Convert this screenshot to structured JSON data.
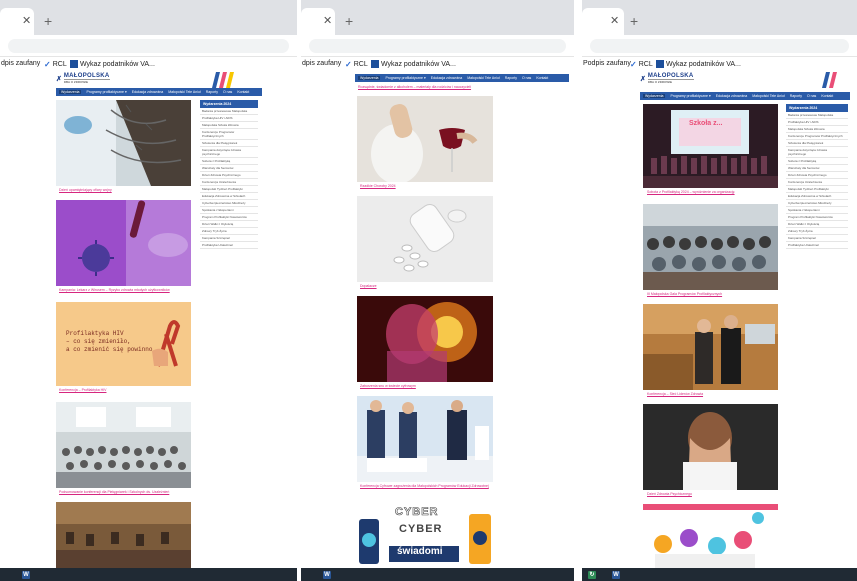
{
  "bookmarks": {
    "trusted_sig": "dpis zaufany",
    "trusted_sig_full": "Podpis zaufany",
    "rcl": "RCL",
    "tax_list": "Wykaz podatników VA..."
  },
  "site": {
    "logo_title": "MAŁOPOLSKA",
    "logo_sub": "DBA O ZDROWIE",
    "nav": [
      "Wydarzenia",
      "Programy profilaktyczne ▾",
      "Edukacja zdrowotna",
      "Małopolski Tele Anioł",
      "Raporty",
      "O nas",
      "Kontakt"
    ],
    "sidebar_title": "Wydarzenia 2024",
    "sidebar_items": [
      "Badania przesiewowe Małopolska",
      "Profilaktyka HIV i AIDS",
      "Małopolska Szkoła Zdrowia",
      "Konferencje Programów Profilaktycznych",
      "Szkolenia dla Pielęgniarek",
      "Kampania dotycząca zdrowia psychicznego",
      "Sobota z Profilaktyką",
      "Warsztaty dla Seniorów",
      "Dzień Zdrowia Psychicznego",
      "Konferencja Uzależnienia",
      "Małopolski Tydzień Profilaktyki",
      "Edukacja Zdrowotna w Szkołach",
      "Cyberbezpieczeństwo Młodzieży",
      "Spotkania z Ekspertami",
      "Program Profilaktyki Nowotworów",
      "Dzień Walki z Otyłością",
      "Zdrowy Tryb Życia",
      "Kampania Szczepień",
      "Profilaktyka Uzależnień"
    ]
  },
  "shot1": {
    "captions": [
      "Dzień upamiętniający ofiary wojny",
      "Kampania: Lekarz z Wirusem – Ryzyko zdrowia młodych użytkowników",
      "Konferencja – Profilaktyka HIV",
      "Podsumowanie konferencji dla Pielęgniarek i Szkolnych ds. Uzależnień",
      ""
    ],
    "hiv_title_line1": "Profilaktyka HIV",
    "hiv_title_line2": "– co się zmieniło,",
    "hiv_title_line3": "a co zmienić się powinno."
  },
  "shot2": {
    "captions": [
      "Rozsądnie, świadomie z alkoholem – materiały dla rodziców i nauczycieli",
      "Rzadkie Choroby 2024",
      "Dopalacze",
      "Zaburzenia snu w świecie cyfrowym",
      "Konferencja Cyfrowe zagrożenia dla Małopolskich Programów Edukacji Zdrowotnej"
    ],
    "cyber_line1": "CYBER",
    "cyber_line2": "CYBER",
    "cyber_line3": "świadomi"
  },
  "shot3": {
    "captions": [
      "Sobota z Profilaktyką 2024 – wyróżnienie za organizację",
      "III Małopolska Gala Programów Profilaktycznych",
      "Konferencja – Sieć Liderów Zdrowia",
      "Dzień Zdrowia Psychicznego",
      ""
    ],
    "stage_text": "Szkoła z..."
  },
  "colors": {
    "navbar": "#2a5ba8",
    "caption_link": "#d6267f",
    "taskbar": "#202a34",
    "tabstrip": "#dfe1e5"
  }
}
